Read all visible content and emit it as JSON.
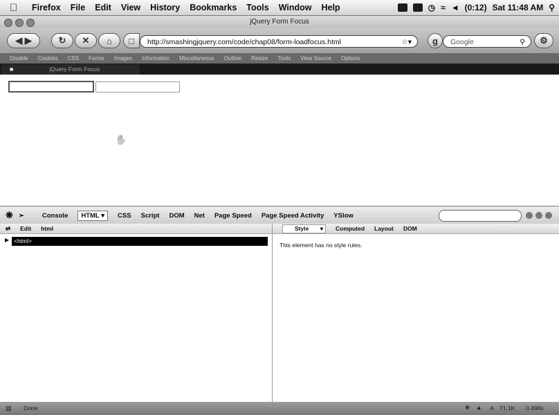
{
  "menubar": {
    "app_name": "Firefox",
    "items": [
      "File",
      "Edit",
      "View",
      "History",
      "Bookmarks",
      "Tools",
      "Window",
      "Help"
    ],
    "battery": "(0:12)",
    "clock": "Sat 11:48 AM"
  },
  "window": {
    "title": "jQuery Form Focus"
  },
  "nav": {
    "url": "http://smashingjquery.com/code/chap08/form-loadfocus.html",
    "search_placeholder": "Google"
  },
  "webdev_toolbar": {
    "items": [
      "Disable",
      "Cookies",
      "CSS",
      "Forms",
      "Images",
      "Information",
      "Miscellaneous",
      "Outline",
      "Resize",
      "Tools",
      "View Source",
      "Options"
    ]
  },
  "tab": {
    "label": "jQuery Form Focus"
  },
  "firebug": {
    "tabs": [
      "Console",
      "HTML",
      "CSS",
      "Script",
      "DOM",
      "Net",
      "Page Speed",
      "Page Speed Activity",
      "YSlow"
    ],
    "selected_tab": "HTML",
    "html_toolbar": [
      "Edit",
      "html"
    ],
    "html_node": "<html>",
    "side_tabs": [
      "Style",
      "Computed",
      "Layout",
      "DOM"
    ],
    "style_message": "This element has no style rules."
  },
  "status": {
    "text": "Done",
    "size": "71.1K",
    "time": "0.498s"
  }
}
